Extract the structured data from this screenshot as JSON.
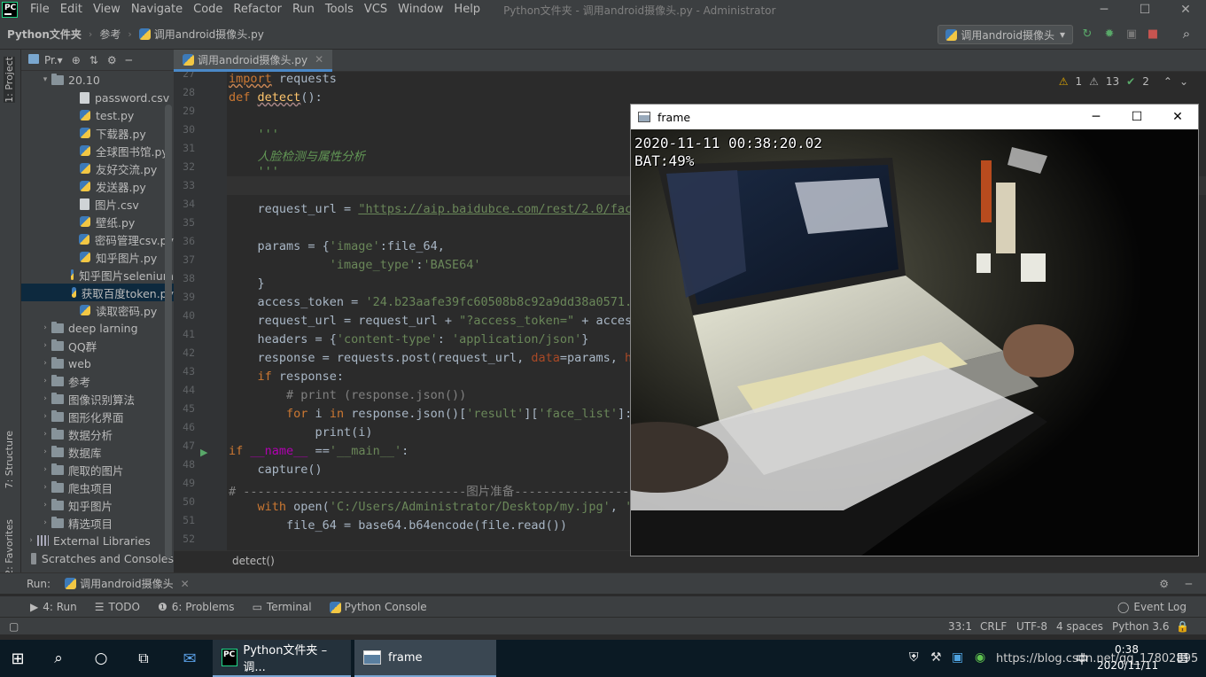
{
  "titlebar": {
    "menu": [
      "File",
      "Edit",
      "View",
      "Navigate",
      "Code",
      "Refactor",
      "Run",
      "Tools",
      "VCS",
      "Window",
      "Help"
    ],
    "title": "Python文件夹 - 调用android摄像头.py - Administrator",
    "logo": "PC"
  },
  "nav": {
    "crumbs": [
      "Python文件夹",
      "参考",
      "调用android摄像头.py"
    ],
    "run_config": "调用android摄像头"
  },
  "side_labels": {
    "project": "1: Project",
    "structure": "7: Structure",
    "favorites": "2: Favorites"
  },
  "project": {
    "header": "Pr.▾",
    "rows": [
      {
        "label": "20.10",
        "type": "folder",
        "indent": 1,
        "arrow": "▾"
      },
      {
        "label": "password.csv",
        "type": "file",
        "indent": 3
      },
      {
        "label": "test.py",
        "type": "py",
        "indent": 3
      },
      {
        "label": "下载器.py",
        "type": "py",
        "indent": 3
      },
      {
        "label": "全球图书馆.py",
        "type": "py",
        "indent": 3
      },
      {
        "label": "友好交流.py",
        "type": "py",
        "indent": 3
      },
      {
        "label": "发送器.py",
        "type": "py",
        "indent": 3
      },
      {
        "label": "图片.csv",
        "type": "file",
        "indent": 3
      },
      {
        "label": "壁纸.py",
        "type": "py",
        "indent": 3
      },
      {
        "label": "密码管理csv.py",
        "type": "py",
        "indent": 3
      },
      {
        "label": "知乎图片.py",
        "type": "py",
        "indent": 3
      },
      {
        "label": "知乎图片selenium",
        "type": "py",
        "indent": 3
      },
      {
        "label": "获取百度token.py",
        "type": "py",
        "indent": 3,
        "selected": true
      },
      {
        "label": "读取密码.py",
        "type": "py",
        "indent": 3
      },
      {
        "label": "deep larning",
        "type": "folder",
        "indent": 1,
        "arrow": "›"
      },
      {
        "label": "QQ群",
        "type": "folder",
        "indent": 1,
        "arrow": "›"
      },
      {
        "label": "web",
        "type": "folder",
        "indent": 1,
        "arrow": "›"
      },
      {
        "label": "参考",
        "type": "folder",
        "indent": 1,
        "arrow": "›"
      },
      {
        "label": "图像识别算法",
        "type": "folder",
        "indent": 1,
        "arrow": "›"
      },
      {
        "label": "图形化界面",
        "type": "folder",
        "indent": 1,
        "arrow": "›"
      },
      {
        "label": "数据分析",
        "type": "folder",
        "indent": 1,
        "arrow": "›"
      },
      {
        "label": "数据库",
        "type": "folder",
        "indent": 1,
        "arrow": "›"
      },
      {
        "label": "爬取的图片",
        "type": "folder",
        "indent": 1,
        "arrow": "›"
      },
      {
        "label": "爬虫项目",
        "type": "folder",
        "indent": 1,
        "arrow": "›"
      },
      {
        "label": "知乎图片",
        "type": "folder",
        "indent": 1,
        "arrow": "›"
      },
      {
        "label": "精选项目",
        "type": "folder",
        "indent": 1,
        "arrow": "›"
      },
      {
        "label": "External Libraries",
        "type": "lib",
        "indent": 0,
        "arrow": "›"
      },
      {
        "label": "Scratches and Consoles",
        "type": "scratch",
        "indent": 0,
        "arrow": ""
      }
    ]
  },
  "editor": {
    "tab": "调用android摄像头.py",
    "inspections": {
      "warnings": "1",
      "weak": "13",
      "ok": "2"
    },
    "line_numbers": [
      "27",
      "28",
      "29",
      "30",
      "31",
      "32",
      "33",
      "34",
      "35",
      "36",
      "37",
      "38",
      "39",
      "40",
      "41",
      "42",
      "43",
      "44",
      "45",
      "46",
      "47",
      "48",
      "49",
      "50",
      "51",
      "52"
    ],
    "breadcrumb": "detect()"
  },
  "frame": {
    "title": "frame",
    "timestamp": "2020-11-11  00:38:20.02",
    "battery": "BAT:49%"
  },
  "runbar": {
    "label": "Run:",
    "tab": "调用android摄像头"
  },
  "bottom_tools": [
    {
      "label": "4: Run",
      "icon": "play-icon"
    },
    {
      "label": "TODO",
      "icon": "list-icon"
    },
    {
      "label": "6: Problems",
      "icon": "info-icon"
    },
    {
      "label": "Terminal",
      "icon": "terminal-icon"
    },
    {
      "label": "Python Console",
      "icon": "python-icon"
    }
  ],
  "event_log": "Event Log",
  "status": {
    "position": "33:1",
    "line_sep": "CRLF",
    "encoding": "UTF-8",
    "indent": "4 spaces",
    "interpreter": "Python 3.6"
  },
  "taskbar": {
    "apps": [
      {
        "label": "Python文件夹 – 调..."
      },
      {
        "label": "frame"
      }
    ],
    "time": "0:38",
    "date": "2020/11/11",
    "ime": "中",
    "watermark": "https://blog.csdn.net/qq_17802895"
  }
}
